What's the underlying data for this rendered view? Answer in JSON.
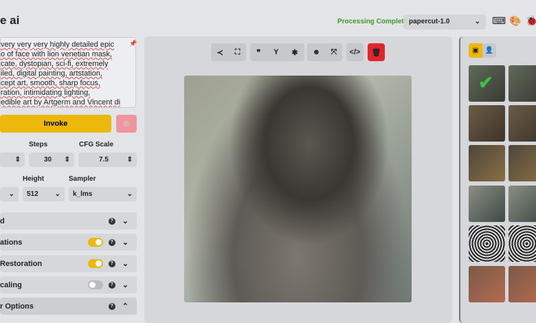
{
  "header": {
    "title": "e ai",
    "status": "Processing Complete",
    "model": "papercut-1.0",
    "icons": [
      "keyboard-icon",
      "palette-icon",
      "bug-icon"
    ]
  },
  "prompt": {
    "lines": [
      "very very very highly detailed epic",
      "o of face with lion venetian mask,",
      "cate, dystopian, sci-fi, extremely",
      "iled, digital painting, artstation,",
      "cept art, smooth, sharp focus,",
      "ration, intimidating lighting,",
      "edible art by Artgerm and Vincent di"
    ]
  },
  "invoke": {
    "label": "Invoke",
    "cancel_icon": "x-circle-icon"
  },
  "params": {
    "steps_label": "Steps",
    "steps": "30",
    "cfg_label": "CFG Scale",
    "cfg": "7.5",
    "height_label": "Height",
    "height": "512",
    "sampler_label": "Sampler",
    "sampler": "k_lms"
  },
  "accordions": [
    {
      "label": "d",
      "toggle": null
    },
    {
      "label": "ations",
      "toggle": true
    },
    {
      "label": " Restoration",
      "toggle": true
    },
    {
      "label": "caling",
      "toggle": false
    },
    {
      "label": "r Options",
      "toggle": null,
      "expanded": true
    }
  ],
  "toolbar": {
    "icons": [
      "share-icon",
      "fullscreen-icon",
      "quote-icon",
      "seedling-icon",
      "asterisk-icon",
      "face-icon",
      "expand-icon",
      "code-icon",
      "trash-icon"
    ]
  },
  "gallery": {
    "tabs": [
      "image-icon",
      "user-icon"
    ],
    "count": 12
  },
  "colors": {
    "accent": "#edb80c",
    "danger": "#e0262e",
    "status": "#3e9a2b"
  }
}
